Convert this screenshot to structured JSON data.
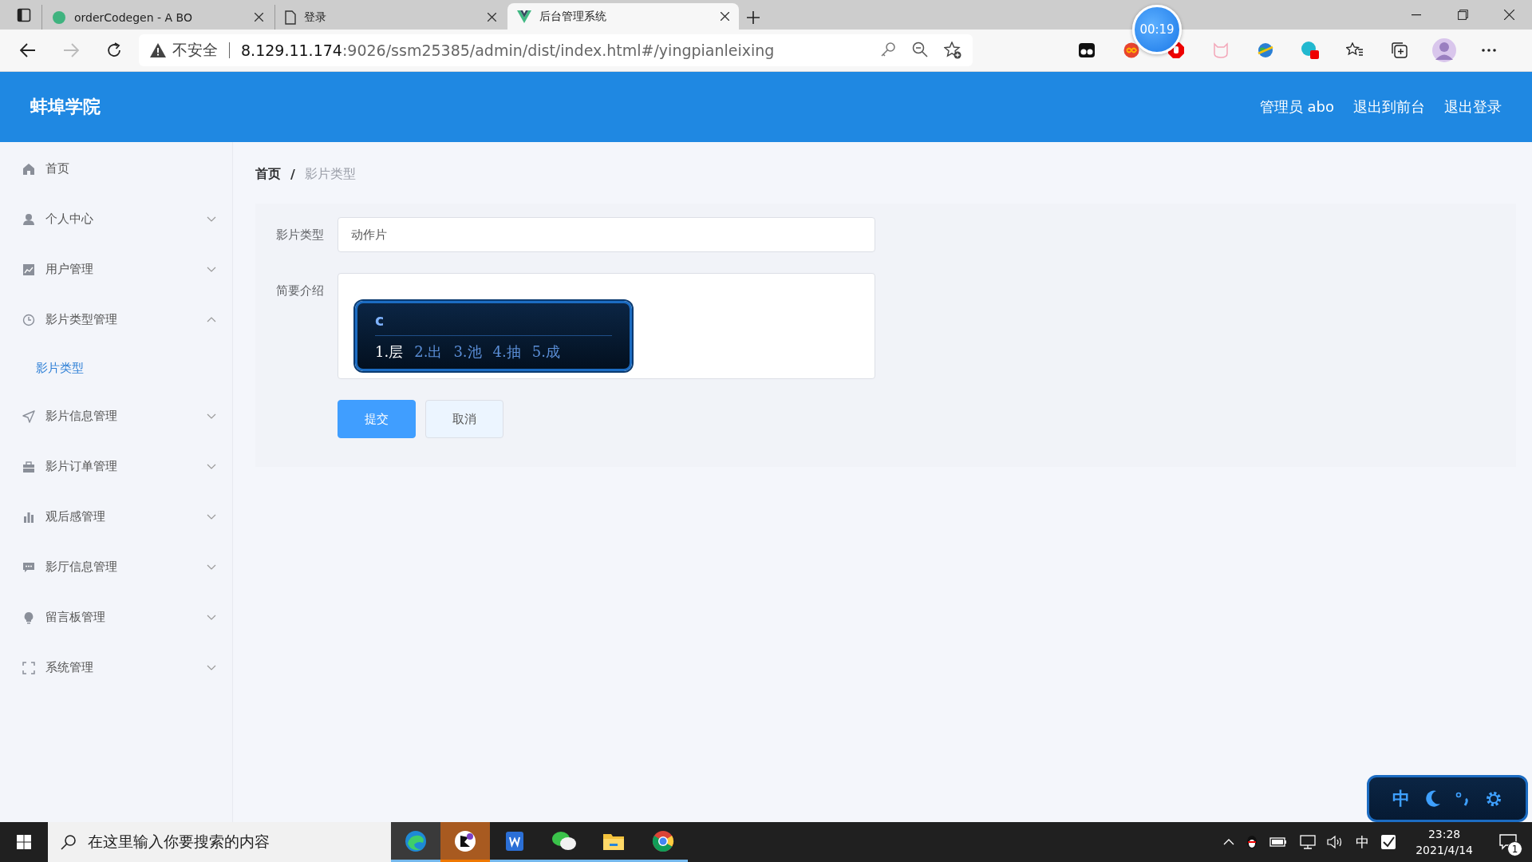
{
  "browser": {
    "tabs": [
      {
        "title": "orderCodegen - A BO",
        "selected": false
      },
      {
        "title": "登录",
        "selected": false
      },
      {
        "title": "后台管理系统",
        "selected": true
      }
    ],
    "security": "不安全",
    "url_host": "8.129.11.174",
    "url_path": ":9026/ssm25385/admin/dist/index.html#/yingpianleixing"
  },
  "timer": "00:19",
  "header": {
    "brand": "蚌埠学院",
    "links": [
      "管理员 abo",
      "退出到前台",
      "退出登录"
    ]
  },
  "sidebar": {
    "items": [
      {
        "label": "首页",
        "kind": "link"
      },
      {
        "label": "个人中心",
        "kind": "submenu",
        "expanded": false
      },
      {
        "label": "用户管理",
        "kind": "submenu",
        "expanded": false
      },
      {
        "label": "影片类型管理",
        "kind": "submenu",
        "expanded": true,
        "children": [
          {
            "label": "影片类型",
            "selected": true
          }
        ]
      },
      {
        "label": "影片信息管理",
        "kind": "submenu",
        "expanded": false
      },
      {
        "label": "影片订单管理",
        "kind": "submenu",
        "expanded": false
      },
      {
        "label": "观后感管理",
        "kind": "submenu",
        "expanded": false
      },
      {
        "label": "影厅信息管理",
        "kind": "submenu",
        "expanded": false
      },
      {
        "label": "留言板管理",
        "kind": "submenu",
        "expanded": false
      },
      {
        "label": "系统管理",
        "kind": "submenu",
        "expanded": false
      }
    ]
  },
  "breadcrumb": [
    "首页",
    "影片类型"
  ],
  "breadcrumb_separator": "/",
  "form": {
    "fields": [
      {
        "label": "影片类型",
        "kind": "input",
        "value": "动作片"
      },
      {
        "label": "简要介绍",
        "kind": "textarea"
      }
    ],
    "buttons": [
      {
        "label": "提交",
        "kind": "primary"
      },
      {
        "label": "取消",
        "kind": "default"
      }
    ]
  },
  "ime_popup": {
    "composition": "c",
    "candidates": [
      {
        "label": "1.层",
        "selected": true
      },
      {
        "label": "2.出",
        "selected": false
      },
      {
        "label": "3.池",
        "selected": false
      },
      {
        "label": "4.抽",
        "selected": false
      },
      {
        "label": "5.成",
        "selected": false
      }
    ]
  },
  "ime_status": {
    "mode": "中"
  },
  "taskbar": {
    "search_placeholder": "在这里输入你要搜索的内容",
    "apps": [
      {
        "active": true
      },
      {
        "active": true
      },
      {
        "active": false
      },
      {
        "active": false
      },
      {
        "active": false
      },
      {
        "active": false
      }
    ],
    "input_mode": "中",
    "time": "23:28",
    "date": "2021/4/14",
    "notifications": "1"
  }
}
